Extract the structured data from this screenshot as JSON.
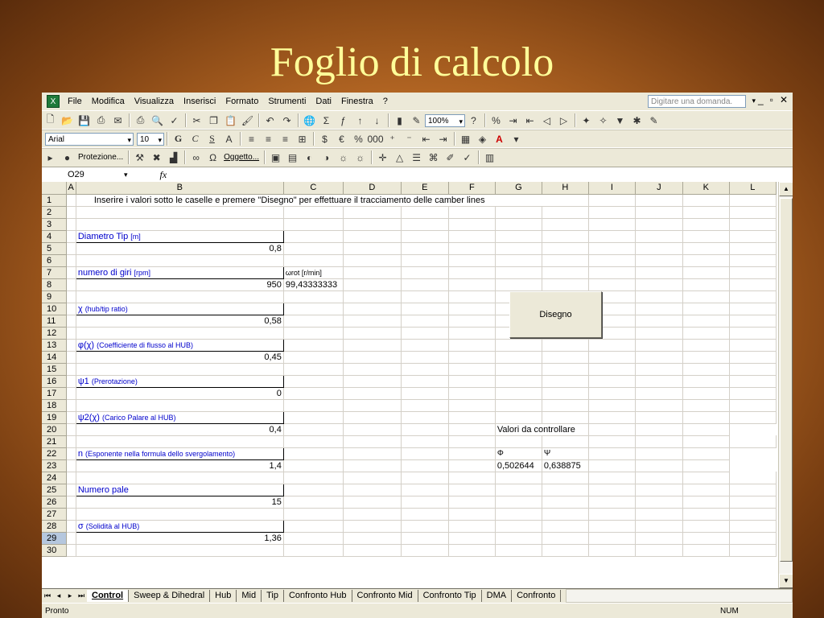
{
  "slide": {
    "title": "Foglio di calcolo"
  },
  "app": {
    "menu": [
      "File",
      "Modifica",
      "Visualizza",
      "Inserisci",
      "Formato",
      "Strumenti",
      "Dati",
      "Finestra",
      "?"
    ],
    "ask_placeholder": "Digitare una domanda.",
    "zoom": "100%",
    "font_name": "Arial",
    "font_size": "10",
    "format_letters": {
      "bold": "G",
      "italic": "C",
      "underline": "S"
    },
    "protection_label": "Protezione...",
    "object_label": "Oggetto...",
    "name_box": "O29",
    "fx_label": "fx"
  },
  "columns": [
    "A",
    "B",
    "C",
    "D",
    "E",
    "F",
    "G",
    "H",
    "I",
    "J",
    "K",
    "L"
  ],
  "rows": [
    "1",
    "2",
    "3",
    "4",
    "5",
    "6",
    "7",
    "8",
    "9",
    "10",
    "11",
    "12",
    "13",
    "14",
    "15",
    "16",
    "17",
    "18",
    "19",
    "20",
    "21",
    "22",
    "23",
    "24",
    "25",
    "26",
    "27",
    "28",
    "29",
    "30"
  ],
  "sheet": {
    "instruction": "Inserire i valori sotto le caselle e premere \"Disegno\" per effettuare il tracciamento delle camber lines",
    "diam_label": "Diametro Tip",
    "diam_unit": "[m]",
    "diam_value": "0,8",
    "giri_label": "numero di giri",
    "giri_unit": "[rpm]",
    "giri_value": "950",
    "wrot_label": "ωrot  [r/min]",
    "wrot_value": "99,43333333",
    "chi_label": "χ",
    "chi_desc": "(hub/tip ratio)",
    "chi_value": "0,58",
    "phi_label": "φ(χ)",
    "phi_desc": "(Coefficiente di flusso al HUB)",
    "phi_value": "0,45",
    "psi1_label": "ψ1",
    "psi1_desc": "(Prerotazione)",
    "psi1_value": "0",
    "psi2_label": "ψ2(χ)",
    "psi2_desc": "(Carico Palare al HUB)",
    "psi2_value": "0,4",
    "n_label": "n",
    "n_desc": "(Esponente nella formula dello svergolamento)",
    "n_value": "1,4",
    "pale_label": "Numero pale",
    "pale_value": "15",
    "sigma_label": "σ",
    "sigma_desc": "(Solidità al HUB)",
    "sigma_value": "1,36",
    "check_label": "Valori da controllare",
    "check_phi_label": "Φ",
    "check_psi_label": "Ψ",
    "check_phi_value": "0,502644",
    "check_psi_value": "0,638875"
  },
  "button": {
    "disegno": "Disegno"
  },
  "tabs": [
    "Control",
    "Sweep & Dihedral",
    "Hub",
    "Mid",
    "Tip",
    "Confronto Hub",
    "Confronto Mid",
    "Confronto Tip",
    "DMA",
    "Confronto"
  ],
  "status": {
    "left": "Pronto",
    "right": "NUM"
  }
}
